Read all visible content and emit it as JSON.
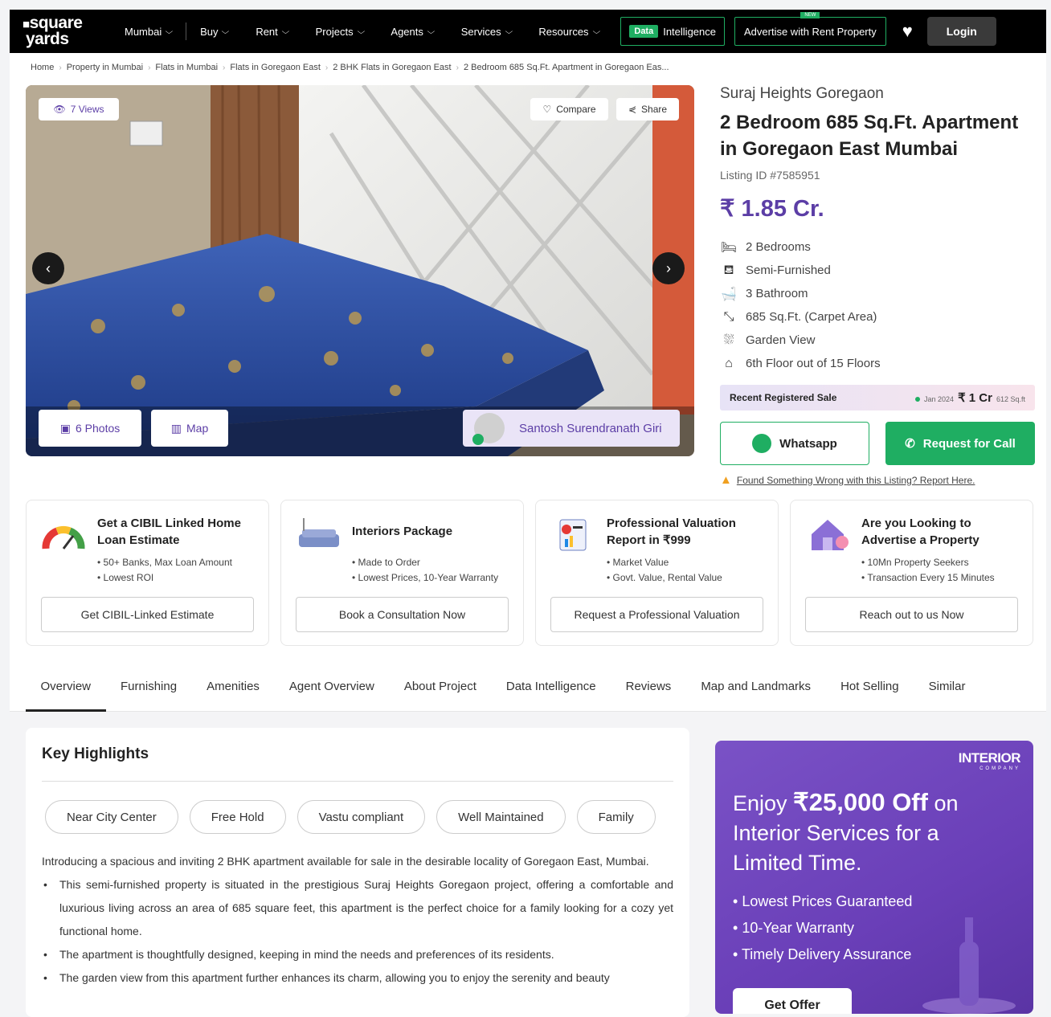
{
  "header": {
    "logo_line1": "square",
    "logo_line2": "yards",
    "city": "Mumbai",
    "nav": [
      "Buy",
      "Rent",
      "Projects",
      "Agents",
      "Services",
      "Resources"
    ],
    "data_tag": "Data",
    "data_label": "Intelligence",
    "advertise": "Advertise with Rent Property",
    "advertise_tag": "NEW",
    "login": "Login"
  },
  "breadcrumbs": [
    "Home",
    "Property in Mumbai",
    "Flats in Mumbai",
    "Flats in Goregaon East",
    "2 BHK Flats in Goregaon East",
    "2 Bedroom 685 Sq.Ft. Apartment in Goregaon Eas..."
  ],
  "gallery": {
    "views": "7 Views",
    "compare": "Compare",
    "share": "Share",
    "photos": "6 Photos",
    "map": "Map",
    "agent": "Santosh Surendranath Giri"
  },
  "listing": {
    "project": "Suraj Heights Goregaon",
    "title": "2 Bedroom 685 Sq.Ft. Apartment in Goregaon East Mumbai",
    "id": "Listing ID #7585951",
    "price": "₹ 1.85 Cr.",
    "features": [
      {
        "icon": "bed-icon",
        "text": "2 Bedrooms"
      },
      {
        "icon": "sofa-icon",
        "text": "Semi-Furnished"
      },
      {
        "icon": "bathtub-icon",
        "text": "3 Bathroom"
      },
      {
        "icon": "area-icon",
        "text": "685 Sq.Ft. (Carpet Area)"
      },
      {
        "icon": "garden-icon",
        "text": "Garden View"
      },
      {
        "icon": "floor-icon",
        "text": "6th Floor out of 15 Floors"
      }
    ],
    "recent_sale_label": "Recent Registered Sale",
    "recent_sale_date": "Jan 2024",
    "recent_sale_amount": "₹ 1 Cr",
    "recent_sale_area": "612 Sq.ft",
    "whatsapp": "Whatsapp",
    "request_call": "Request for Call",
    "report": "Found Something Wrong with this Listing? Report Here."
  },
  "cards": [
    {
      "title": "Get a CIBIL Linked Home Loan Estimate",
      "points": [
        "50+ Banks, Max Loan Amount",
        "Lowest ROI"
      ],
      "button": "Get CIBIL-Linked Estimate",
      "icon": "gauge-icon"
    },
    {
      "title": "Interiors Package",
      "points": [
        "Made to Order",
        "Lowest Prices, 10-Year Warranty"
      ],
      "button": "Book a Consultation Now",
      "icon": "sofa-lamp-icon"
    },
    {
      "title": "Professional Valuation Report in ₹999",
      "points": [
        "Market Value",
        "Govt. Value, Rental Value"
      ],
      "button": "Request a Professional Valuation",
      "icon": "report-icon"
    },
    {
      "title": "Are you Looking to Advertise a Property",
      "points": [
        "10Mn Property Seekers",
        "Transaction Every 15 Minutes"
      ],
      "button": "Reach out to us Now",
      "icon": "house-icon"
    }
  ],
  "tabs": [
    "Overview",
    "Furnishing",
    "Amenities",
    "Agent Overview",
    "About Project",
    "Data Intelligence",
    "Reviews",
    "Map and Landmarks",
    "Hot Selling",
    "Similar"
  ],
  "highlights": {
    "heading": "Key Highlights",
    "chips": [
      "Near City Center",
      "Free Hold",
      "Vastu compliant",
      "Well Maintained",
      "Family"
    ],
    "intro": "Introducing a spacious and inviting 2 BHK apartment available for sale in the desirable locality of Goregaon East, Mumbai.",
    "bullets": [
      "This semi-furnished property is situated in the prestigious Suraj Heights Goregaon project, offering a comfortable and luxurious living across an area of 685 square feet, this apartment is the perfect choice for a family looking for a cozy yet functional home.",
      "The apartment is thoughtfully designed, keeping in mind the needs and preferences of its residents.",
      "The garden view from this apartment further enhances its charm, allowing you to enjoy the serenity and beauty"
    ]
  },
  "promo": {
    "brand": "INTERIOR",
    "brand_sub": "COMPANY",
    "line1_pre": "Enjoy ",
    "line1_amount": "₹25,000 Off",
    "line1_post": " on",
    "line2": "Interior Services for a Limited Time.",
    "points": [
      "Lowest Prices Guaranteed",
      "10-Year Warranty",
      "Timely Delivery Assurance"
    ],
    "button": "Get Offer"
  },
  "colors": {
    "brand_purple": "#5c3ea6",
    "green": "#1fae62",
    "topbar": "#000000"
  }
}
